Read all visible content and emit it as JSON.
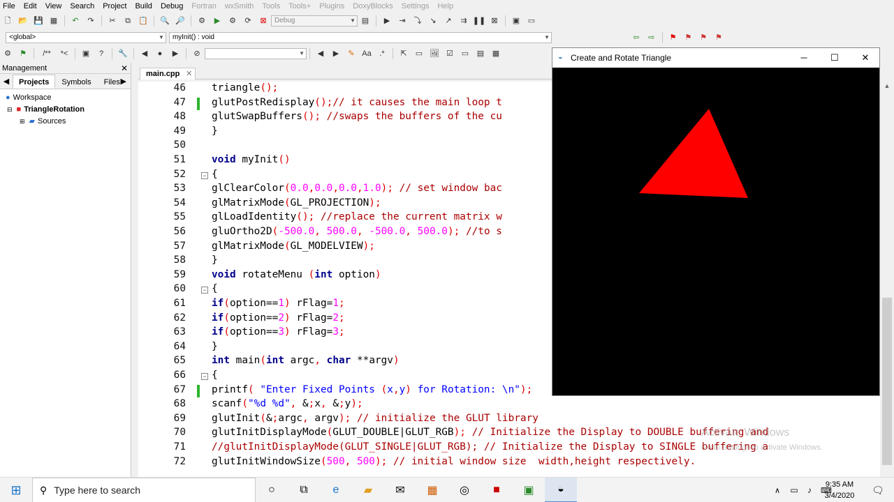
{
  "menu": [
    "File",
    "Edit",
    "View",
    "Search",
    "Project",
    "Build",
    "Debug",
    "Fortran",
    "wxSmith",
    "Tools",
    "Tools+",
    "Plugins",
    "DoxyBlocks",
    "Settings",
    "Help"
  ],
  "toolbar": {
    "build_target": "Debug",
    "scope": "<global>",
    "function": "myInit() : void"
  },
  "management": {
    "title": "Management",
    "tabs": [
      "Projects",
      "Symbols",
      "Files"
    ],
    "workspace": "Workspace",
    "project": "TriangleRotation",
    "sources": "Sources"
  },
  "editor": {
    "tab": "main.cpp",
    "lines": [
      {
        "n": "46",
        "t": "triangle();"
      },
      {
        "n": "47",
        "t": "glutPostRedisplay();// it causes the main loop t"
      },
      {
        "n": "48",
        "t": "glutSwapBuffers(); //swaps the buffers of the cu"
      },
      {
        "n": "49",
        "t": "}"
      },
      {
        "n": "50",
        "t": ""
      },
      {
        "n": "51",
        "t": "void myInit()"
      },
      {
        "n": "52",
        "t": "{"
      },
      {
        "n": "53",
        "t": "glClearColor(0.0,0.0,0.0,1.0); // set window bac"
      },
      {
        "n": "54",
        "t": "glMatrixMode(GL_PROJECTION);"
      },
      {
        "n": "55",
        "t": "glLoadIdentity(); //replace the current matrix w"
      },
      {
        "n": "56",
        "t": "gluOrtho2D(-500.0, 500.0, -500.0, 500.0); //to s"
      },
      {
        "n": "57",
        "t": "glMatrixMode(GL_MODELVIEW);"
      },
      {
        "n": "58",
        "t": "}"
      },
      {
        "n": "59",
        "t": "void rotateMenu (int option)"
      },
      {
        "n": "60",
        "t": "{"
      },
      {
        "n": "61",
        "t": "if(option==1) rFlag=1;"
      },
      {
        "n": "62",
        "t": "if(option==2) rFlag=2;"
      },
      {
        "n": "63",
        "t": "if(option==3) rFlag=3;"
      },
      {
        "n": "64",
        "t": "}"
      },
      {
        "n": "65",
        "t": "int main(int argc, char **argv)"
      },
      {
        "n": "66",
        "t": "{"
      },
      {
        "n": "67",
        "t": "printf( \"Enter Fixed Points (x,y) for Rotation: \\n\");"
      },
      {
        "n": "68",
        "t": "scanf(\"%d %d\", &x, &y);"
      },
      {
        "n": "69",
        "t": "glutInit(&argc, argv); // initialize the GLUT library"
      },
      {
        "n": "70",
        "t": "glutInitDisplayMode(GLUT_DOUBLE|GLUT_RGB); // Initialize the Display to DOUBLE buffering and"
      },
      {
        "n": "71",
        "t": "//glutInitDisplayMode(GLUT_SINGLE|GLUT_RGB); // Initialize the Display to SINGLE buffering a"
      },
      {
        "n": "72",
        "t": "glutInitWindowSize(500, 500); // initial window size  width,height respectively."
      }
    ]
  },
  "glwindow": {
    "title": "Create and Rotate Triangle",
    "triangle_color": "#ff0000"
  },
  "watermark": {
    "line1": "Activate Windows",
    "line2": "Go to Settings to activate Windows."
  },
  "taskbar": {
    "search_placeholder": "Type here to search",
    "time": "9:35 AM",
    "date": "3/4/2020"
  }
}
